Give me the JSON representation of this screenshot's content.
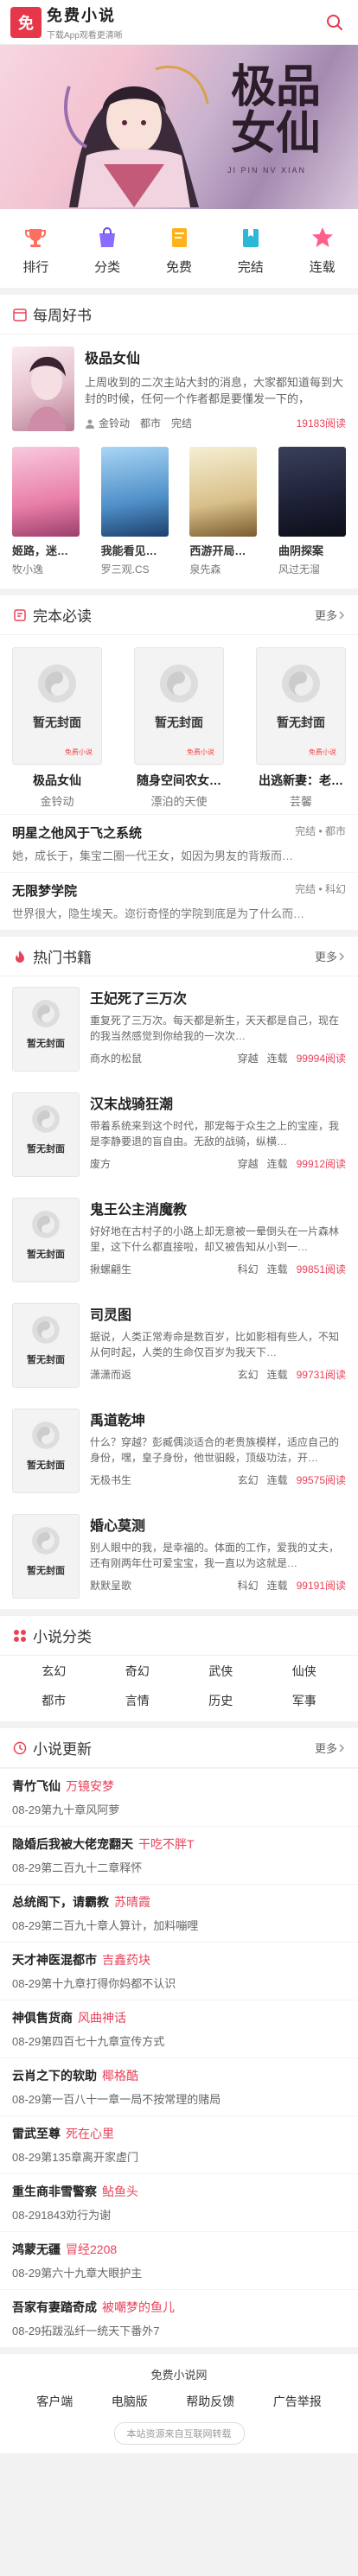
{
  "header": {
    "logo_char": "免",
    "title": "免费小说",
    "subtitle": "下载App观看更清晰"
  },
  "banner": {
    "title": "极品女仙",
    "subtitle": "JI PIN NV XIAN"
  },
  "nav": [
    {
      "label": "排行",
      "icon": "trophy-icon",
      "color": "#ff6f61"
    },
    {
      "label": "分类",
      "icon": "bag-icon",
      "color": "#8a6cff"
    },
    {
      "label": "免费",
      "icon": "book-icon",
      "color": "#ffb21c"
    },
    {
      "label": "完结",
      "icon": "bookmark-icon",
      "color": "#29b9d6"
    },
    {
      "label": "连载",
      "icon": "star-icon",
      "color": "#ff5f8a"
    }
  ],
  "weekly": {
    "title": "每周好书",
    "featured": {
      "title": "极品女仙",
      "intro": "上周收到的二次主站大封的消息，大家都知道每到大封的时候，任何一个作者都是要懂发一下的，",
      "author": "金铃动",
      "category": "都市",
      "status": "完结",
      "reads": "19183阅读"
    },
    "books": [
      {
        "name": "姬路，迷…",
        "author": "牧小逸"
      },
      {
        "name": "我能看见…",
        "author": "罗三观.CS"
      },
      {
        "name": "西游开局…",
        "author": "泉先森"
      },
      {
        "name": "曲阴探案",
        "author": "风过无溜"
      }
    ]
  },
  "finished": {
    "title": "完本必读",
    "more": "更多",
    "no_cover": "暂无封面",
    "books": [
      {
        "name": "极品女仙",
        "author": "金铃动"
      },
      {
        "name": "随身空间农女…",
        "author": "漂泊的天使"
      },
      {
        "name": "出逃新妻：老…",
        "author": "芸馨"
      }
    ],
    "list": [
      {
        "title": "明星之他风于飞之系统",
        "tag": "完结 • 都市",
        "intro": "她，成长于，集宝二圈一代王女，如因为男友的背叛而…"
      },
      {
        "title": "无限梦学院",
        "tag": "完结 • 科幻",
        "intro": "世界很大，隐生埃天。迩衍奇怪的学院到底是为了什么而…"
      }
    ]
  },
  "hot": {
    "title": "热门书籍",
    "more": "更多",
    "no_cover": "暂无封面",
    "books": [
      {
        "title": "王妃死了三万次",
        "intro": "重复死了三万次。每天都是新生，天天都是自己，现在的我当然感觉到你给我的一次次…",
        "author": "商水的松鼠",
        "category": "穿越",
        "status": "连载",
        "reads": "99994阅读"
      },
      {
        "title": "汉末战骑狂潮",
        "intro": "带着系统来到这个时代，那宠每于众生之上的宝座，我是李静要退的盲自由。无敌的战骑，纵横…",
        "author": "废方",
        "category": "穿越",
        "status": "连载",
        "reads": "99912阅读"
      },
      {
        "title": "鬼王公主消魔教",
        "intro": "好好地在古村子的小路上却无意被一晕倒头在一片森林里，这下什么都直接啦，却又被告知从小到一…",
        "author": "揪螺翩生",
        "category": "科幻",
        "status": "连载",
        "reads": "99851阅读"
      },
      {
        "title": "司灵图",
        "intro": "据说，人类正常寿命是数百岁，比如影相有些人，不知从何时起，人类的生命仅百岁为我天下…",
        "author": "潇潇而返",
        "category": "玄幻",
        "status": "连载",
        "reads": "99731阅读"
      },
      {
        "title": "禹道乾坤",
        "intro": "什么？穿越？彭臧偶淡适合的老贵族模样，适应自己的身份，嘿，皇子身份，他世驲殺，顶级功法，开…",
        "author": "无极书生",
        "category": "玄幻",
        "status": "连载",
        "reads": "99575阅读"
      },
      {
        "title": "婚心莫测",
        "intro": "别人眼中的我，是幸福的。体面的工作，爱我的丈夫，还有刚两年仕可爱宝宝，我一直以为这就是…",
        "author": "默默呈歌",
        "category": "科幻",
        "status": "连载",
        "reads": "99191阅读"
      }
    ]
  },
  "categories": {
    "title": "小说分类",
    "items": [
      "玄幻",
      "奇幻",
      "武侠",
      "仙侠",
      "都市",
      "言情",
      "历史",
      "军事"
    ]
  },
  "updates": {
    "title": "小说更新",
    "more": "更多",
    "items": [
      {
        "title": "青竹飞仙",
        "author": "万镜安梦",
        "sub": "08-29第九十章风阿萝"
      },
      {
        "title": "隐婚后我被大佬宠翻天",
        "author": "干吃不胖T",
        "sub": "08-29第二百九十二章释怀"
      },
      {
        "title": "总统阁下，请霸教",
        "author": "苏晴霞",
        "sub": "08-29第二百九十章人算计，加料嘣哩"
      },
      {
        "title": "天才神医混都市",
        "author": "吉鑫药块",
        "sub": "08-29第十九章打得你妈都不认识"
      },
      {
        "title": "神俱售货商",
        "author": "风曲神话",
        "sub": "08-29第四百七十九章宣传方式"
      },
      {
        "title": "云肖之下的软助",
        "author": "椰格酷",
        "sub": "08-29第一百八十一章一局不按常理的赌局"
      },
      {
        "title": "雷武至尊",
        "author": "死在心里",
        "sub": "08-29第135章离开家虚门"
      },
      {
        "title": "重生商非雪警察",
        "author": "鲇鱼头",
        "sub": "08-291843劝行为谢"
      },
      {
        "title": "鸿蒙无疆",
        "author": "冒经2208",
        "sub": "08-29第六十九章大眼护主"
      },
      {
        "title": "吾家有妻踏奇成",
        "author": "被嘲梦的鱼儿",
        "sub": "08-29拓跋泓纤一统天下番外7"
      }
    ]
  },
  "footer": {
    "name": "免费小说网",
    "links": [
      "客户端",
      "电脑版",
      "帮助反馈",
      "广告举报"
    ],
    "note": "本站资源来自互联网转载"
  }
}
